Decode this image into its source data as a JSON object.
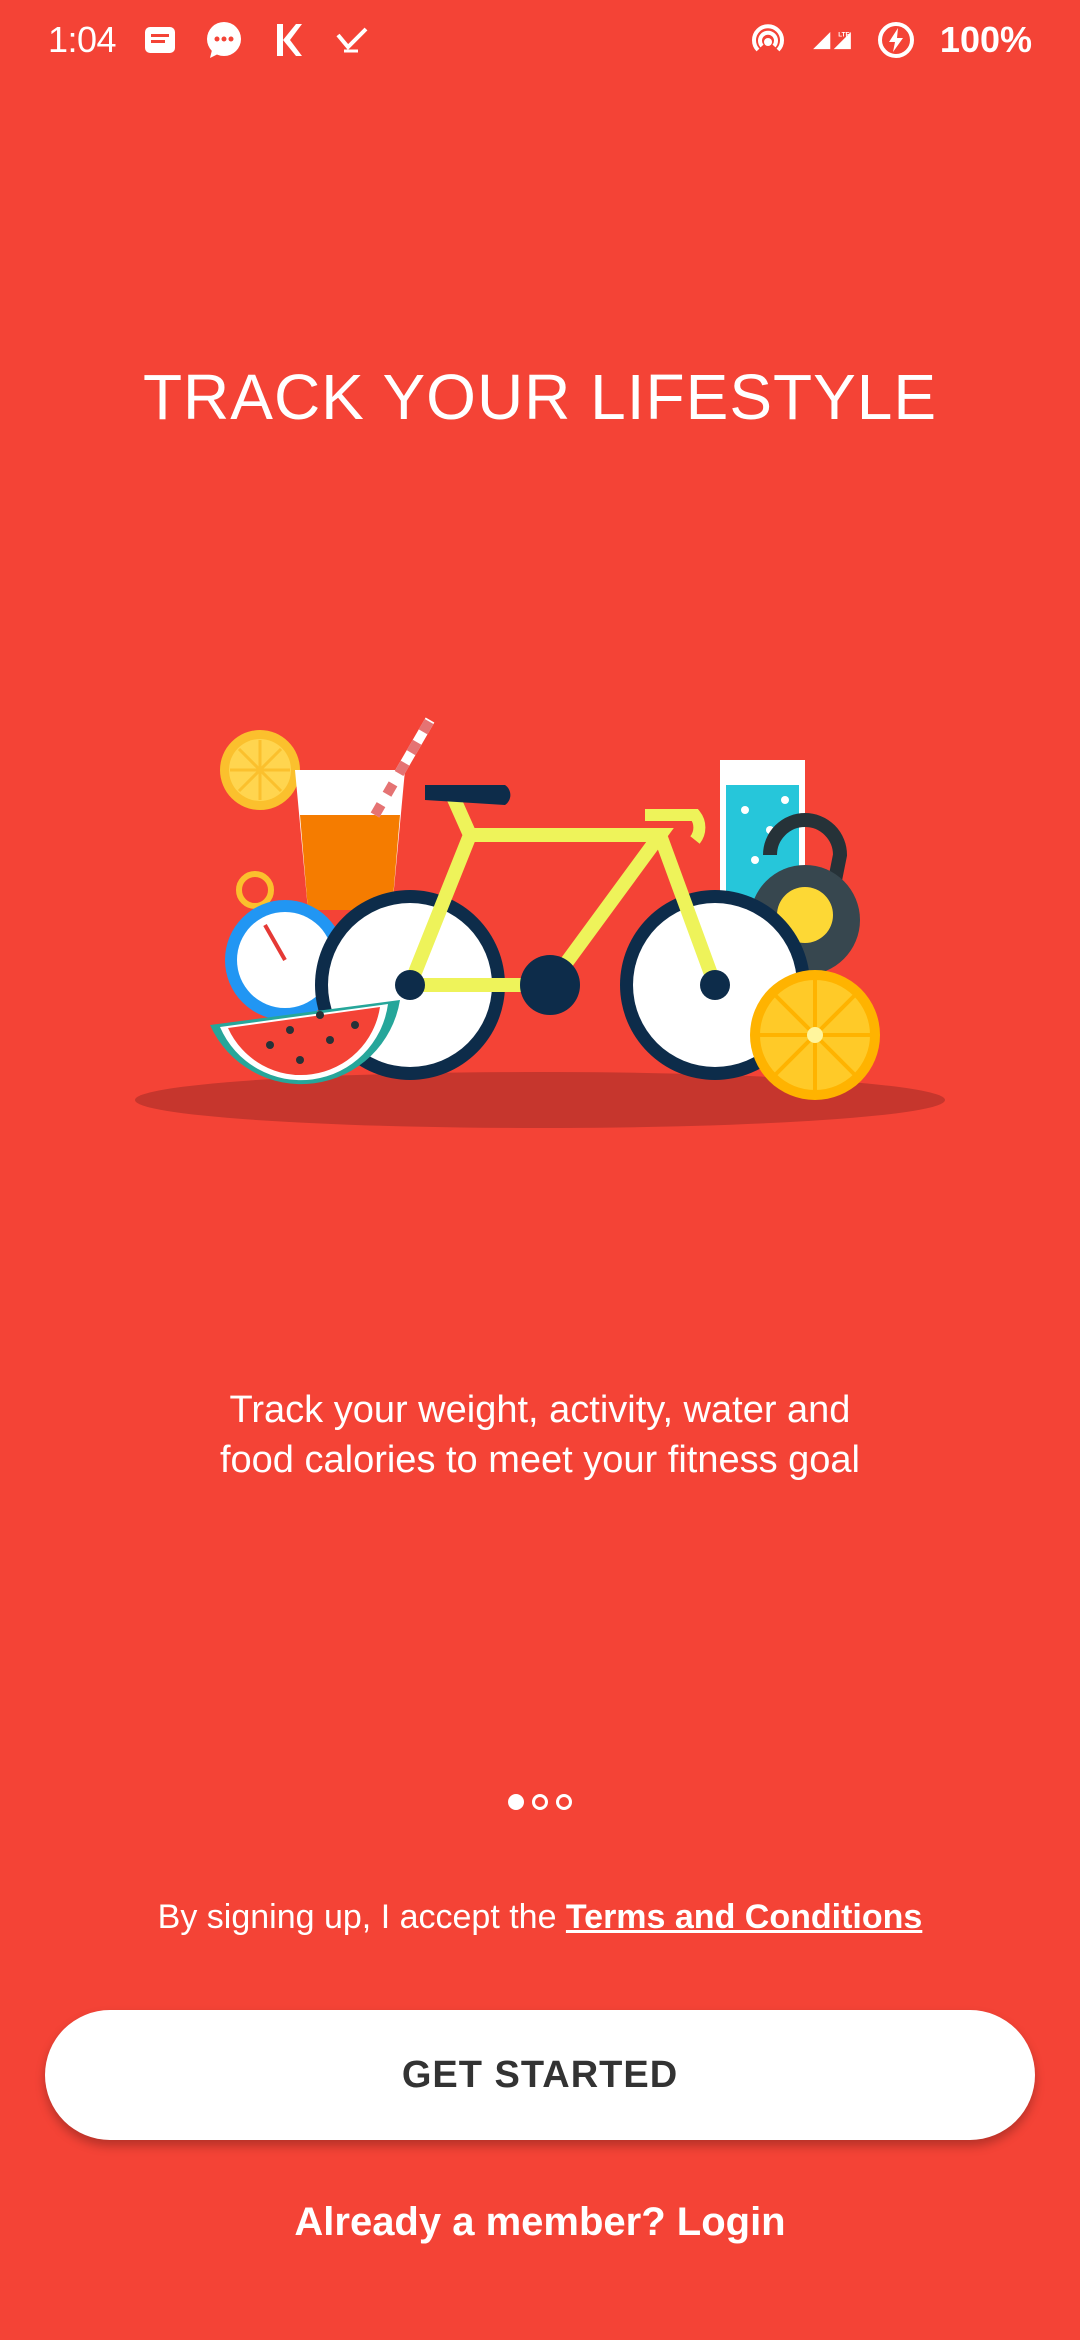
{
  "status_bar": {
    "time": "1:04",
    "battery": "100%",
    "icons": [
      "messages-icon",
      "chat-icon",
      "k-icon",
      "check-icon",
      "hotspot-icon",
      "signal-icon",
      "lte-icon",
      "battery-saver-icon"
    ]
  },
  "onboarding": {
    "headline": "TRACK YOUR LIFESTYLE",
    "description_line1": "Track your weight, activity, water and",
    "description_line2": "food calories to meet your fitness goal",
    "page_indicator": {
      "total": 3,
      "active": 0
    }
  },
  "terms": {
    "prefix": "By signing up, I accept the ",
    "link_label": "Terms and Conditions"
  },
  "actions": {
    "get_started_label": "GET STARTED",
    "member_prompt": "Already a member? ",
    "login_label": "Login"
  },
  "colors": {
    "background": "#F44336",
    "button_bg": "#FFFFFF",
    "button_text": "#333333"
  }
}
